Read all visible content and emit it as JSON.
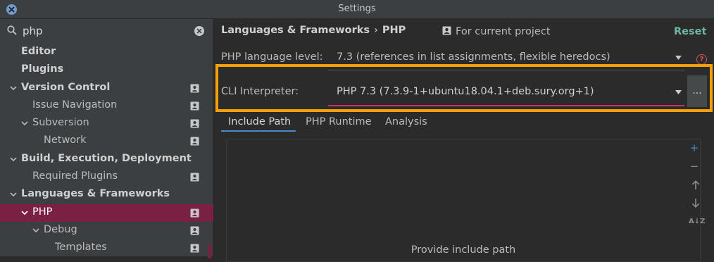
{
  "window": {
    "title": "Settings"
  },
  "search": {
    "value": "php"
  },
  "tree": [
    {
      "label": "Editor",
      "level": 0,
      "bold": true,
      "chevron": false,
      "proj": false,
      "selected": false
    },
    {
      "label": "Plugins",
      "level": 0,
      "bold": true,
      "chevron": false,
      "proj": false,
      "selected": false
    },
    {
      "label": "Version Control",
      "level": 0,
      "bold": true,
      "chevron": true,
      "proj": true,
      "selected": false
    },
    {
      "label": "Issue Navigation",
      "level": 1,
      "bold": false,
      "chevron": false,
      "proj": true,
      "selected": false
    },
    {
      "label": "Subversion",
      "level": 1,
      "bold": false,
      "chevron": true,
      "proj": true,
      "selected": false
    },
    {
      "label": "Network",
      "level": 2,
      "bold": false,
      "chevron": false,
      "proj": true,
      "selected": false
    },
    {
      "label": "Build, Execution, Deployment",
      "level": 0,
      "bold": true,
      "chevron": true,
      "proj": false,
      "selected": false
    },
    {
      "label": "Required Plugins",
      "level": 1,
      "bold": false,
      "chevron": false,
      "proj": true,
      "selected": false
    },
    {
      "label": "Languages & Frameworks",
      "level": 0,
      "bold": true,
      "chevron": true,
      "proj": false,
      "selected": false
    },
    {
      "label": "PHP",
      "level": 1,
      "bold": false,
      "chevron": true,
      "proj": true,
      "selected": true
    },
    {
      "label": "Debug",
      "level": 2,
      "bold": false,
      "chevron": true,
      "proj": true,
      "selected": false
    },
    {
      "label": "Templates",
      "level": 3,
      "bold": false,
      "chevron": false,
      "proj": true,
      "selected": false
    }
  ],
  "header": {
    "crumb_parent": "Languages & Frameworks",
    "crumb_separator": "›",
    "crumb_current": "PHP",
    "scope": "For current project",
    "reset": "Reset"
  },
  "php_level": {
    "label": "PHP language level:",
    "value": "7.3 (references in list assignments, flexible heredocs)",
    "help": "?"
  },
  "cli": {
    "label": "CLI Interpreter:",
    "value": "PHP 7.3 (7.3.9-1+ubuntu18.04.1+deb.sury.org+1)",
    "browse": "..."
  },
  "tabs": [
    "Include Path",
    "PHP Runtime",
    "Analysis"
  ],
  "include_path": {
    "empty_text": "Provide include path"
  },
  "colors": {
    "accent": "#4a88c7",
    "selection": "#7a2042",
    "highlight": "#f3a10a",
    "reset": "#6fb5a3"
  }
}
